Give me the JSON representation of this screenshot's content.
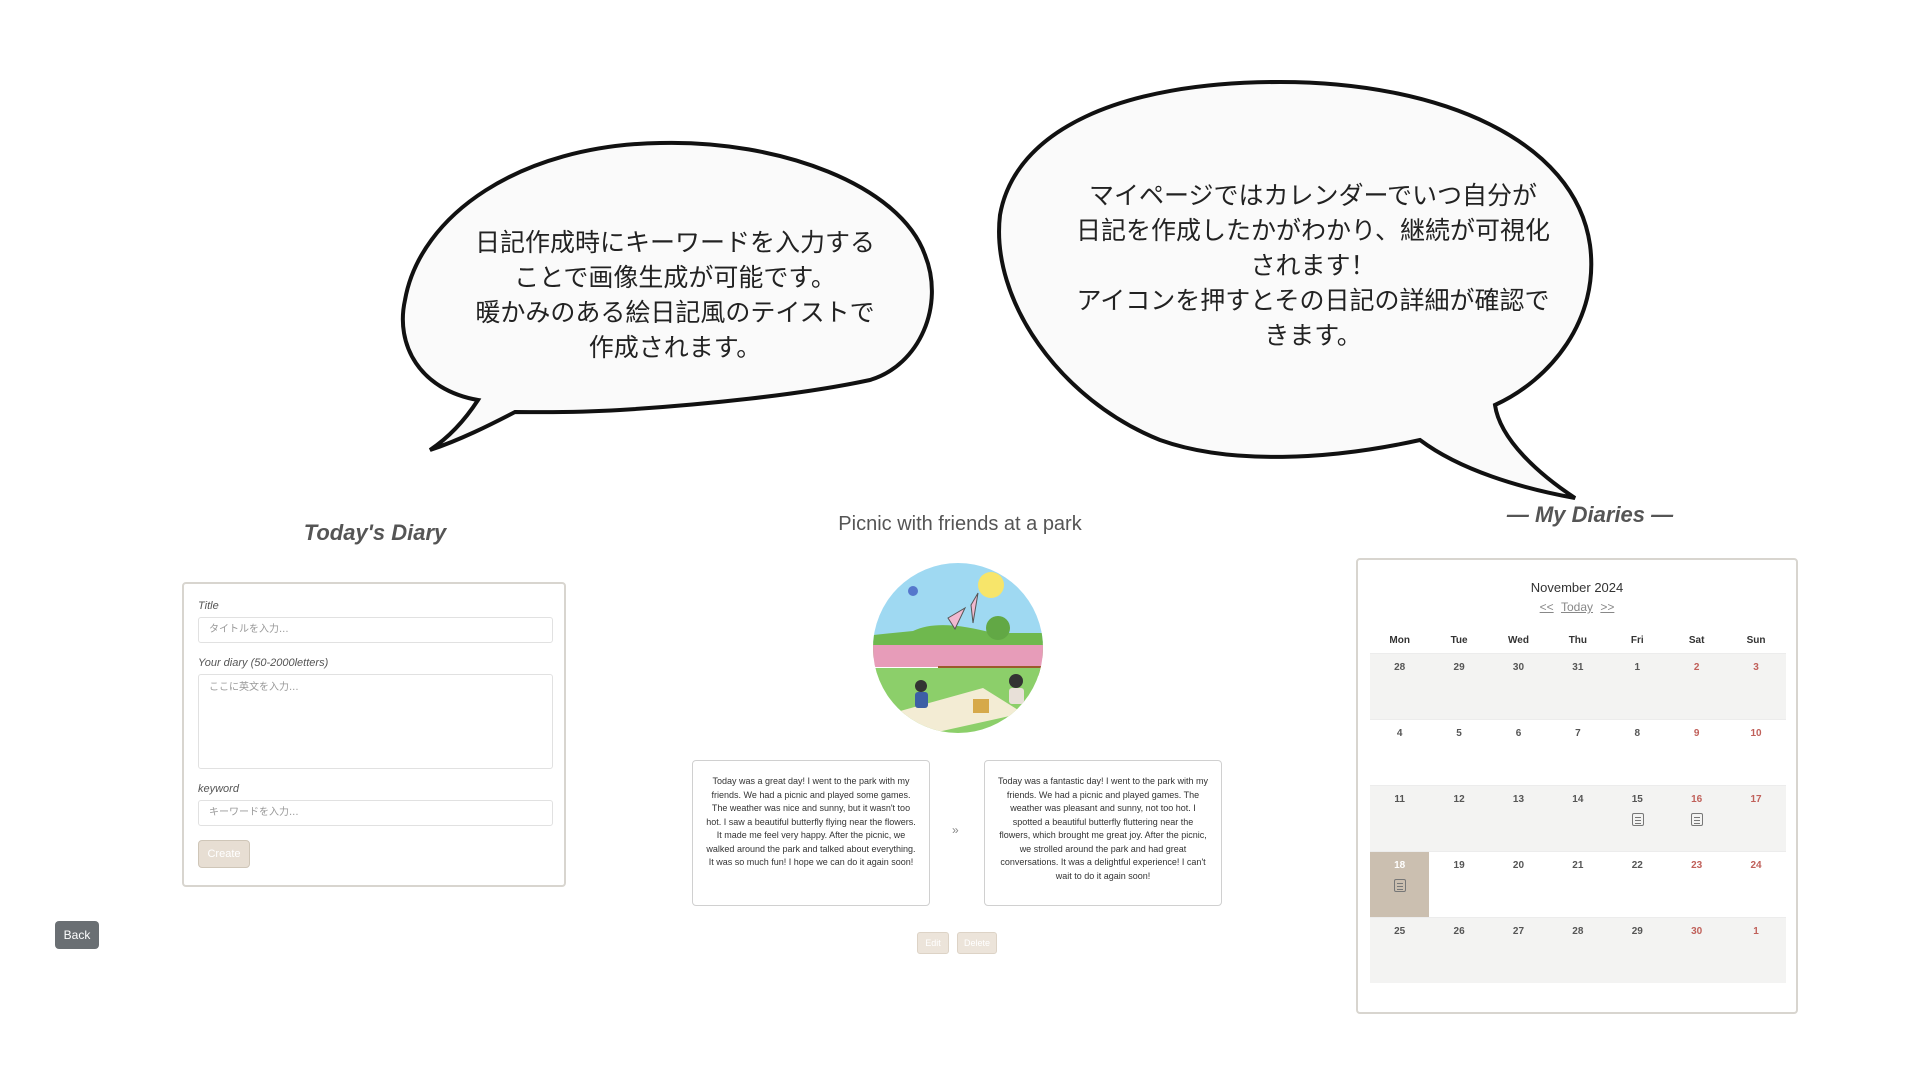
{
  "callouts": {
    "left": {
      "lines": [
        "日記作成時にキーワードを入力する",
        "ことで画像生成が可能です。",
        "暖かみのある絵日記風のテイストで",
        "作成されます。"
      ]
    },
    "right": {
      "lines": [
        "マイページではカレンダーでいつ自分が",
        "日記を作成したかがわかり、継続が可視化",
        "されます！",
        "アイコンを押すとその日記の詳細が確認で",
        "きます。"
      ]
    }
  },
  "today_diary": {
    "title": "Today's Diary",
    "title_label": "Title",
    "title_placeholder": "タイトルを入力...",
    "diary_label": "Your diary (50-2000letters)",
    "diary_placeholder": "ここに英文を入力...",
    "keyword_label": "keyword",
    "keyword_placeholder": "キーワードを入力...",
    "create_label": "Create"
  },
  "back_label": "Back",
  "entry": {
    "title": "Picnic with friends at a park",
    "original_text": "Today was a great day! I went to the park with my friends. We had a picnic and played some games. The weather was nice and sunny, but it wasn't too hot. I saw a beautiful butterfly flying near the flowers. It made me feel very happy. After the picnic, we walked around the park and talked about everything. It was so much fun! I hope we can do it again soon!",
    "revised_text": "Today was a fantastic day! I went to the park with my friends. We had a picnic and played games. The weather was pleasant and sunny, not too hot. I spotted a beautiful butterfly fluttering near the flowers, which brought me great joy. After the picnic, we strolled around the park and had great conversations. It was a delightful experience! I can't wait to do it again soon!",
    "arrow": "»",
    "edit_label": "Edit",
    "delete_label": "Delete"
  },
  "my_diaries": {
    "title": "— My Diaries —",
    "month": "November 2024",
    "nav_prev": "<<",
    "nav_today": "Today",
    "nav_next": ">>",
    "weekdays": [
      "Mon",
      "Tue",
      "Wed",
      "Thu",
      "Fri",
      "Sat",
      "Sun"
    ],
    "weeks": [
      [
        "28",
        "29",
        "30",
        "31",
        "1",
        "2",
        "3"
      ],
      [
        "4",
        "5",
        "6",
        "7",
        "8",
        "9",
        "10"
      ],
      [
        "11",
        "12",
        "13",
        "14",
        "15",
        "16",
        "17"
      ],
      [
        "18",
        "19",
        "20",
        "21",
        "22",
        "23",
        "24"
      ],
      [
        "25",
        "26",
        "27",
        "28",
        "29",
        "30",
        "1"
      ]
    ],
    "diary_days": [
      "2-4",
      "2-5",
      "3-0"
    ],
    "today_cell": "3-0",
    "weekend_color": "#c0605a",
    "today_color": "#cbbfb0"
  }
}
